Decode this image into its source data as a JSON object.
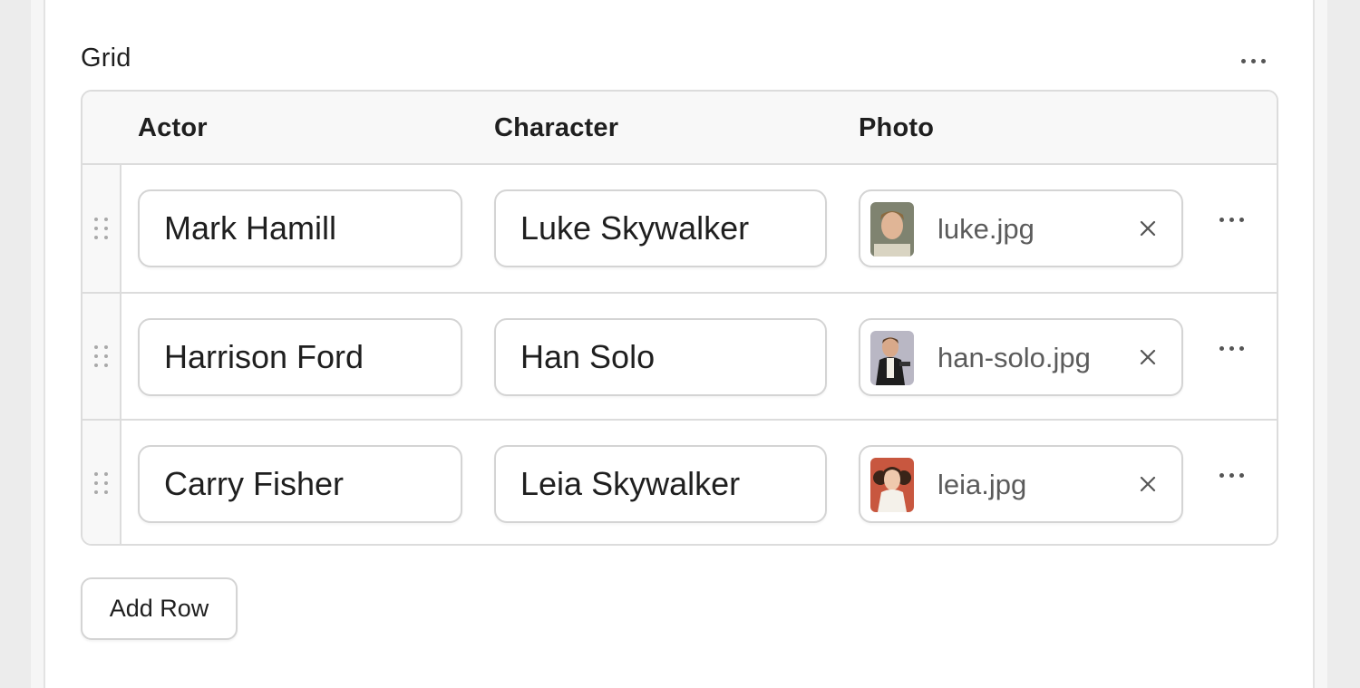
{
  "section": {
    "title": "Grid"
  },
  "grid": {
    "columns": [
      "Actor",
      "Character",
      "Photo"
    ],
    "rows": [
      {
        "actor": "Mark Hamill",
        "character": "Luke Skywalker",
        "photo": "luke.jpg",
        "thumb_color": "#8a8f7a"
      },
      {
        "actor": "Harrison Ford",
        "character": "Han Solo",
        "photo": "han-solo.jpg",
        "thumb_color": "#b9b7c4"
      },
      {
        "actor": "Carry Fisher",
        "character": "Leia Skywalker",
        "photo": "leia.jpg",
        "thumb_color": "#c8573f"
      }
    ]
  },
  "actions": {
    "add_row_label": "Add Row"
  },
  "icons": {
    "section_menu": "more-horizontal-icon",
    "row_menu": "more-horizontal-icon",
    "drag_handle": "drag-handle-icon",
    "remove": "close-icon"
  },
  "colors": {
    "border": "#dcdcdc",
    "header_bg": "#f8f8f8",
    "text": "#1f1f1f",
    "muted_text": "#5b5b5b"
  }
}
